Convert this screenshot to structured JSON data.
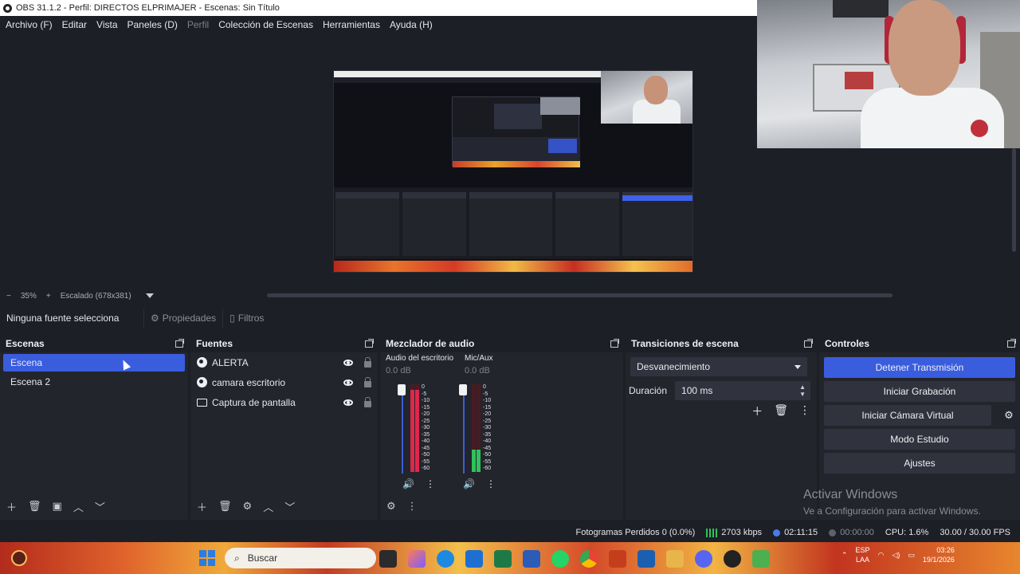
{
  "window": {
    "title": "OBS 31.1.2 - Perfil: DIRECTOS ELPRIMAJER - Escenas: Sin Título"
  },
  "menu": {
    "items": [
      "Archivo (F)",
      "Editar",
      "Vista",
      "Paneles (D)",
      "Perfil",
      "Colección de Escenas",
      "Herramientas",
      "Ayuda (H)"
    ]
  },
  "zoom": {
    "minus": "−",
    "level": "35%",
    "plus": "+",
    "scale": "Escalado (678x381)"
  },
  "source_toolbar": {
    "no_selection": "Ninguna fuente selecciona",
    "properties": "Propiedades",
    "filters": "Filtros"
  },
  "scenes": {
    "title": "Escenas",
    "items": [
      "Escena",
      "Escena 2"
    ],
    "selected_index": 0
  },
  "sources": {
    "title": "Fuentes",
    "items": [
      {
        "name": "ALERTA",
        "icon": "browser-icon"
      },
      {
        "name": "camara escritorio",
        "icon": "browser-icon"
      },
      {
        "name": "Captura de pantalla",
        "icon": "display-capture-icon"
      }
    ]
  },
  "mixer": {
    "title": "Mezclador de audio",
    "channels": [
      {
        "name": "Audio del escritorio",
        "db": "0.0 dB",
        "level": 0.94,
        "meter_color": "#e0274a"
      },
      {
        "name": "Mic/Aux",
        "db": "0.0 dB",
        "level": 0.25,
        "meter_color": "#2ec25a"
      }
    ],
    "ticks": [
      "0",
      "-5",
      "-10",
      "-15",
      "-20",
      "-25",
      "-30",
      "-35",
      "-40",
      "-45",
      "-50",
      "-55",
      "-60"
    ]
  },
  "transitions": {
    "title": "Transiciones de escena",
    "selected": "Desvanecimiento",
    "duration_label": "Duración",
    "duration_value": "100 ms"
  },
  "controls": {
    "title": "Controles",
    "buttons": [
      "Detener Transmisión",
      "Iniciar Grabación",
      "Iniciar Cámara Virtual",
      "Modo Estudio",
      "Ajustes"
    ]
  },
  "activation": {
    "line1": "Activar Windows",
    "line2": "Ve a Configuración para activar Windows."
  },
  "status": {
    "dropped": "Fotogramas Perdidos 0 (0.0%)",
    "bitrate": "2703 kbps",
    "stream_time": "02:11:15",
    "rec_time": "00:00:00",
    "cpu": "CPU: 1.6%",
    "fps": "30.00 / 30.00 FPS"
  },
  "taskbar": {
    "search_placeholder": "Buscar",
    "lang1": "ESP",
    "lang2": "LAA",
    "time": "03:26",
    "date": "19/1/2026"
  },
  "colors": {
    "accent": "#3a5dde",
    "panel": "#23252d",
    "background": "#1d1f26"
  }
}
